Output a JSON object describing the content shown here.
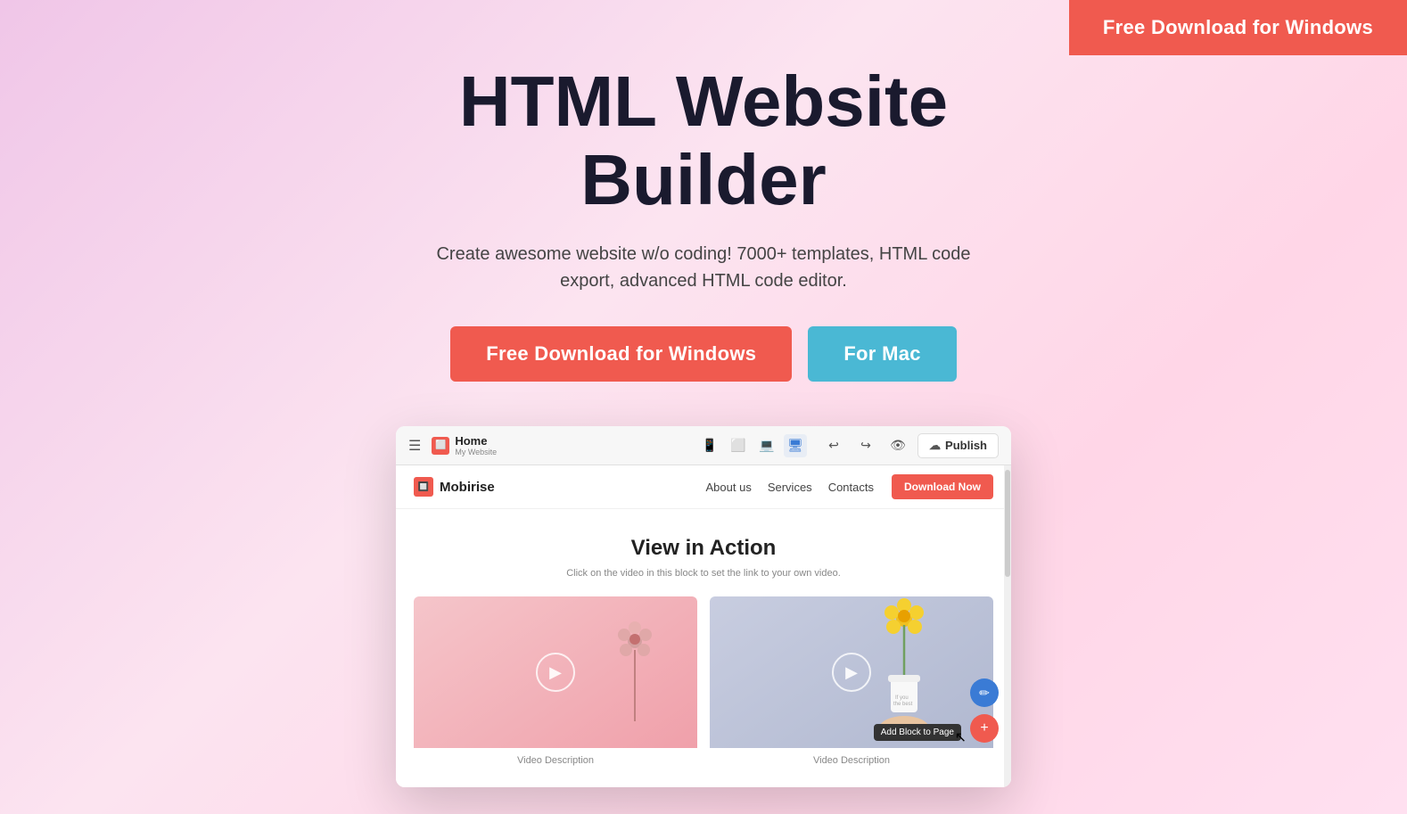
{
  "topBar": {
    "downloadLabel": "Free Download for Windows"
  },
  "hero": {
    "title": "HTML Website Builder",
    "subtitle": "Create awesome website w/o coding! 7000+ templates, HTML code export, advanced HTML code editor.",
    "buttons": {
      "windows": "Free Download for Windows",
      "mac": "For Mac"
    }
  },
  "mockup": {
    "toolbar": {
      "menuIcon": "☰",
      "homeLabel": "Home",
      "homeSublabel": "My Website",
      "publishLabel": "Publish"
    },
    "navbar": {
      "logoName": "Mobirise",
      "links": [
        "About us",
        "Services",
        "Contacts"
      ],
      "downloadBtn": "Download Now"
    },
    "content": {
      "sectionTitle": "View in Action",
      "sectionSub": "Click on the video in this block to set the link to your own video.",
      "videos": [
        {
          "desc": "Video Description"
        },
        {
          "desc": "Video Description"
        }
      ]
    },
    "tooltips": {
      "addBlock": "Add Block to Page"
    }
  }
}
